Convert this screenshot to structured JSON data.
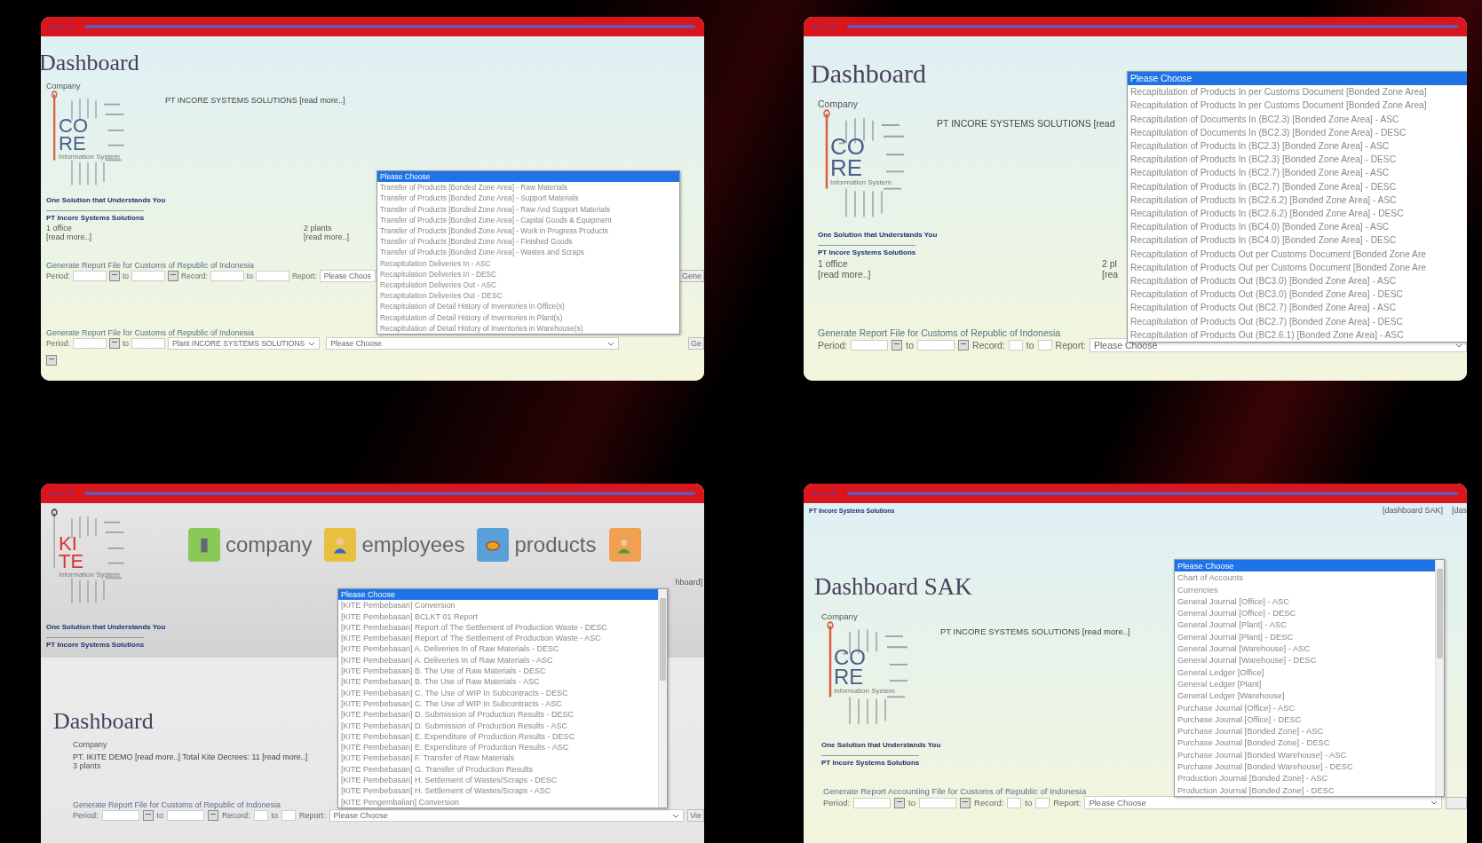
{
  "panels": [
    {
      "title": "Dashboard",
      "company": {
        "legend": "Company",
        "logo": {
          "kind": "core",
          "letters": [
            "CO",
            "RE"
          ],
          "caption": "Information System",
          "tagline": "One Solution that Understands You",
          "owner": "PT Incore Systems Solutions"
        },
        "name": "PT INCORE SYSTEMS SOLUTIONS [read more..]",
        "stats": [
          {
            "count": "1 office",
            "link": "[read more..]"
          },
          {
            "count": "2 plants",
            "link": "[read more..]"
          }
        ]
      },
      "forms": [
        {
          "label": "Generate Report File for Customs of Republic of Indonesia",
          "fields": [
            {
              "kind": "label",
              "text": "Period:"
            },
            {
              "kind": "input"
            },
            {
              "kind": "calendar"
            },
            {
              "kind": "label",
              "text": "to"
            },
            {
              "kind": "input"
            },
            {
              "kind": "calendar"
            },
            {
              "kind": "label",
              "text": "Record:"
            },
            {
              "kind": "small-input"
            },
            {
              "kind": "label",
              "text": "to"
            },
            {
              "kind": "small-input"
            },
            {
              "kind": "label",
              "text": "Report:"
            },
            {
              "kind": "cut-select",
              "text": "Please Choos"
            },
            {
              "kind": "button",
              "text": "Gene"
            }
          ]
        },
        {
          "label": "Generate Report File for Customs of Republic of Indonesia",
          "fields": [
            {
              "kind": "label",
              "text": "Period:"
            },
            {
              "kind": "input"
            },
            {
              "kind": "calendar"
            },
            {
              "kind": "label",
              "text": "to"
            },
            {
              "kind": "input"
            },
            {
              "kind": "select",
              "text": "Plant INCORE SYSTEMS SOLUTIONS"
            },
            {
              "kind": "wide-select",
              "text": "Please Choose"
            },
            {
              "kind": "button",
              "text": "Ge"
            },
            {
              "kind": "break"
            },
            {
              "kind": "calendar"
            }
          ]
        }
      ],
      "dropdown": {
        "options": [
          {
            "label": "Please Choose",
            "selected": true
          },
          {
            "label": "Transfer of Products [Bonded Zone Area] - Raw Materials",
            "selected": false
          },
          {
            "label": "Transfer of Products [Bonded Zone Area] - Support Materials",
            "selected": false
          },
          {
            "label": "Transfer of Products [Bonded Zone Area] - Raw And Support Materials",
            "selected": false
          },
          {
            "label": "Transfer of Products [Bonded Zone Area] - Capital Goods & Equipment",
            "selected": false
          },
          {
            "label": "Transfer of Products [Bonded Zone Area] - Work in Progress Products",
            "selected": false
          },
          {
            "label": "Transfer of Products [Bonded Zone Area] - Finished Goods",
            "selected": false
          },
          {
            "label": "Transfer of Products [Bonded Zone Area] - Wastes and Scraps",
            "selected": false
          },
          {
            "label": "Recapitulation Deliveries In - ASC",
            "selected": false
          },
          {
            "label": "Recapitulation Deliveries In - DESC",
            "selected": false
          },
          {
            "label": "Recapitulation Deliveries Out - ASC",
            "selected": false
          },
          {
            "label": "Recapitulation Deliveries Out - DESC",
            "selected": false
          },
          {
            "label": "Recapitulation of Detail History of Inventories in Office(s)",
            "selected": false
          },
          {
            "label": "Recapitulation of Detail History of Inventories in Plant(s)",
            "selected": false
          },
          {
            "label": "Recapitulation of Detail History of Inventories in Warehouse(s)",
            "selected": false
          }
        ]
      }
    },
    {
      "title": "Dashboard",
      "company": {
        "legend": "Company",
        "logo": {
          "kind": "core",
          "letters": [
            "CO",
            "RE"
          ],
          "caption": "Information System",
          "tagline": "One Solution that Understands You",
          "owner": "PT Incore Systems Solutions"
        },
        "name": "PT INCORE SYSTEMS SOLUTIONS [read",
        "stats": [
          {
            "count": "1 office",
            "link": "[read more..]"
          },
          {
            "count": "2 pl",
            "link": "[rea"
          }
        ]
      },
      "forms": [
        {
          "label": "Generate Report File for Customs of Republic of Indonesia",
          "fields": [
            {
              "kind": "label",
              "text": "Period:"
            },
            {
              "kind": "input"
            },
            {
              "kind": "calendar"
            },
            {
              "kind": "label",
              "text": "to"
            },
            {
              "kind": "input"
            },
            {
              "kind": "calendar"
            },
            {
              "kind": "label",
              "text": "Record:"
            },
            {
              "kind": "small-input"
            },
            {
              "kind": "label",
              "text": "to"
            },
            {
              "kind": "small-input"
            },
            {
              "kind": "label",
              "text": "Report:"
            },
            {
              "kind": "wide-select",
              "text": "Please Choose"
            }
          ]
        }
      ],
      "dropdown": {
        "options": [
          {
            "label": "Please Choose",
            "selected": true
          },
          {
            "label": "Recapitulation of Products In per Customs Document [Bonded Zone Area]",
            "selected": false
          },
          {
            "label": "Recapitulation of Products In per Customs Document [Bonded Zone Area]",
            "selected": false
          },
          {
            "label": "Recapitulation of Documents In (BC2.3) [Bonded Zone Area] - ASC",
            "selected": false
          },
          {
            "label": "Recapitulation of Documents In (BC2.3) [Bonded Zone Area] - DESC",
            "selected": false
          },
          {
            "label": "Recapitulation of Products In (BC2.3) [Bonded Zone Area] - ASC",
            "selected": false
          },
          {
            "label": "Recapitulation of Products In (BC2.3) [Bonded Zone Area] - DESC",
            "selected": false
          },
          {
            "label": "Recapitulation of Products In (BC2.7) [Bonded Zone Area] - ASC",
            "selected": false
          },
          {
            "label": "Recapitulation of Products In (BC2.7) [Bonded Zone Area] - DESC",
            "selected": false
          },
          {
            "label": "Recapitulation of Products In (BC2.6.2) [Bonded Zone Area] - ASC",
            "selected": false
          },
          {
            "label": "Recapitulation of Products In (BC2.6.2) [Bonded Zone Area] - DESC",
            "selected": false
          },
          {
            "label": "Recapitulation of Products In (BC4.0) [Bonded Zone Area] - ASC",
            "selected": false
          },
          {
            "label": "Recapitulation of Products In (BC4.0) [Bonded Zone Area] - DESC",
            "selected": false
          },
          {
            "label": "Recapitulation of Products Out per Customs Document [Bonded Zone Are",
            "selected": false
          },
          {
            "label": "Recapitulation of Products Out per Customs Document [Bonded Zone Are",
            "selected": false
          },
          {
            "label": "Recapitulation of Products Out (BC3.0) [Bonded Zone Area] - ASC",
            "selected": false
          },
          {
            "label": "Recapitulation of Products Out (BC3.0) [Bonded Zone Area] - DESC",
            "selected": false
          },
          {
            "label": "Recapitulation of Products Out (BC2.7) [Bonded Zone Area] - ASC",
            "selected": false
          },
          {
            "label": "Recapitulation of Products Out (BC2.7) [Bonded Zone Area] - DESC",
            "selected": false
          },
          {
            "label": "Recapitulation of Products Out (BC2.6.1) [Bonded Zone Area] - ASC",
            "selected": false
          }
        ]
      }
    },
    {
      "title": "Dashboard",
      "header": {
        "kind": "nav",
        "logo": {
          "kind": "kite",
          "letters": [
            "KI",
            "TE"
          ],
          "caption": "Information System",
          "tagline": "One Solution that Understands You",
          "owner": "PT Incore Systems Solutions"
        },
        "nav": [
          {
            "kind": "labeled",
            "label": "company"
          },
          {
            "kind": "labeled",
            "label": "employees"
          },
          {
            "kind": "labeled",
            "label": "products"
          },
          {
            "kind": "icon-only"
          }
        ],
        "links": [
          "hboard]"
        ]
      },
      "company": {
        "legend": "Company",
        "name": "PT. IKITE DEMO [read more..]   Total Kite Decrees: 11 [read more..]",
        "stats": [
          {
            "count": "3 plants"
          }
        ]
      },
      "forms": [
        {
          "label": "Generate Report File for Customs of Republic of Indonesia",
          "fields": [
            {
              "kind": "label",
              "text": "Period:"
            },
            {
              "kind": "input"
            },
            {
              "kind": "calendar"
            },
            {
              "kind": "label",
              "text": "to"
            },
            {
              "kind": "input"
            },
            {
              "kind": "calendar"
            },
            {
              "kind": "label",
              "text": "Record:"
            },
            {
              "kind": "small-input"
            },
            {
              "kind": "label",
              "text": "to"
            },
            {
              "kind": "small-input"
            },
            {
              "kind": "label",
              "text": "Report:"
            },
            {
              "kind": "wide-select",
              "text": "Please Choose"
            },
            {
              "kind": "button",
              "text": "Vie"
            }
          ]
        }
      ],
      "dropdown": {
        "options": [
          {
            "label": "Please Choose",
            "selected": true
          },
          {
            "label": "[KITE Pembebasan] Conversion",
            "selected": false
          },
          {
            "label": "[KITE Pembebasan] BCLKT 01 Report",
            "selected": false
          },
          {
            "label": "[KITE Pembebasan] Report of The Settlement of Production Waste - DESC",
            "selected": false
          },
          {
            "label": "[KITE Pembebasan] Report of The Settlement of Production Waste - ASC",
            "selected": false
          },
          {
            "label": "[KITE Pembebasan] A. Deliveries In of Raw Materials - DESC",
            "selected": false
          },
          {
            "label": "[KITE Pembebasan] A. Deliveries In of Raw Materials - ASC",
            "selected": false
          },
          {
            "label": "[KITE Pembebasan] B. The Use of Raw Materials - DESC",
            "selected": false
          },
          {
            "label": "[KITE Pembebasan] B. The Use of Raw Materials - ASC",
            "selected": false
          },
          {
            "label": "[KITE Pembebasan] C. The Use of WIP In Subcontracts - DESC",
            "selected": false
          },
          {
            "label": "[KITE Pembebasan] C. The Use of WIP In Subcontracts - ASC",
            "selected": false
          },
          {
            "label": "[KITE Pembebasan] D. Submission of Production Results - DESC",
            "selected": false
          },
          {
            "label": "[KITE Pembebasan] D. Submission of Production Results - ASC",
            "selected": false
          },
          {
            "label": "[KITE Pembebasan] E. Expenditure of Production Results - DESC",
            "selected": false
          },
          {
            "label": "[KITE Pembebasan] E. Expenditure of Production Results - ASC",
            "selected": false
          },
          {
            "label": "[KITE Pembebasan] F. Transfer of Raw Materials",
            "selected": false
          },
          {
            "label": "[KITE Pembebasan] G. Transfer of Production Results",
            "selected": false
          },
          {
            "label": "[KITE Pembebasan] H. Settlement of Wastes/Scraps - DESC",
            "selected": false
          },
          {
            "label": "[KITE Pembebasan] H. Settlement of Wastes/Scraps - ASC",
            "selected": false
          },
          {
            "label": "[KITE Pengembalian] Conversion",
            "selected": false
          }
        ]
      }
    },
    {
      "title": "Dashboard SAK",
      "header": {
        "kind": "links",
        "owner": "PT Incore Systems Solutions",
        "links": [
          "[dashboard SAK]",
          "[das"
        ]
      },
      "company": {
        "legend": "Company",
        "logo": {
          "kind": "core",
          "letters": [
            "CO",
            "RE"
          ],
          "caption": "Information System",
          "tagline": "One Solution that Understands You",
          "owner": "PT Incore Systems Solutions"
        },
        "name": "PT INCORE SYSTEMS SOLUTIONS [read more..]"
      },
      "forms": [
        {
          "label": "Generate Report Accounting File for Customs of Republic of Indonesia",
          "fields": [
            {
              "kind": "label",
              "text": "Period:"
            },
            {
              "kind": "input"
            },
            {
              "kind": "calendar"
            },
            {
              "kind": "label",
              "text": "to"
            },
            {
              "kind": "input"
            },
            {
              "kind": "calendar"
            },
            {
              "kind": "label",
              "text": "Record:"
            },
            {
              "kind": "small-input"
            },
            {
              "kind": "label",
              "text": "to"
            },
            {
              "kind": "small-input"
            },
            {
              "kind": "label",
              "text": "Report:"
            },
            {
              "kind": "wide-select",
              "text": "Please Choose"
            },
            {
              "kind": "blank-button"
            }
          ]
        }
      ],
      "dropdown": {
        "options": [
          {
            "label": "Please Choose",
            "selected": true
          },
          {
            "label": "Chart of Accounts",
            "selected": false
          },
          {
            "label": "Currencies",
            "selected": false
          },
          {
            "label": "General Journal [Office] - ASC",
            "selected": false
          },
          {
            "label": "General Journal [Office] - DESC",
            "selected": false
          },
          {
            "label": "General Journal [Plant] - ASC",
            "selected": false
          },
          {
            "label": "General Journal [Plant] - DESC",
            "selected": false
          },
          {
            "label": "General Journal [Warehouse] - ASC",
            "selected": false
          },
          {
            "label": "General Journal [Warehouse] - DESC",
            "selected": false
          },
          {
            "label": "General Ledger [Office]",
            "selected": false
          },
          {
            "label": "General Ledger [Plant]",
            "selected": false
          },
          {
            "label": "General Ledger [Warehouse]",
            "selected": false
          },
          {
            "label": "Purchase Journal [Office] - ASC",
            "selected": false
          },
          {
            "label": "Purchase Journal [Office] - DESC",
            "selected": false
          },
          {
            "label": "Purchase Journal [Bonded Zone] - ASC",
            "selected": false
          },
          {
            "label": "Purchase Journal [Bonded Zone] - DESC",
            "selected": false
          },
          {
            "label": "Purchase Journal [Bonded Warehouse] - ASC",
            "selected": false
          },
          {
            "label": "Purchase Journal [Bonded Warehouse] - DESC",
            "selected": false
          },
          {
            "label": "Production Journal [Bonded Zone] - ASC",
            "selected": false
          },
          {
            "label": "Production Journal [Bonded Zone] - DESC",
            "selected": false
          }
        ]
      }
    }
  ]
}
